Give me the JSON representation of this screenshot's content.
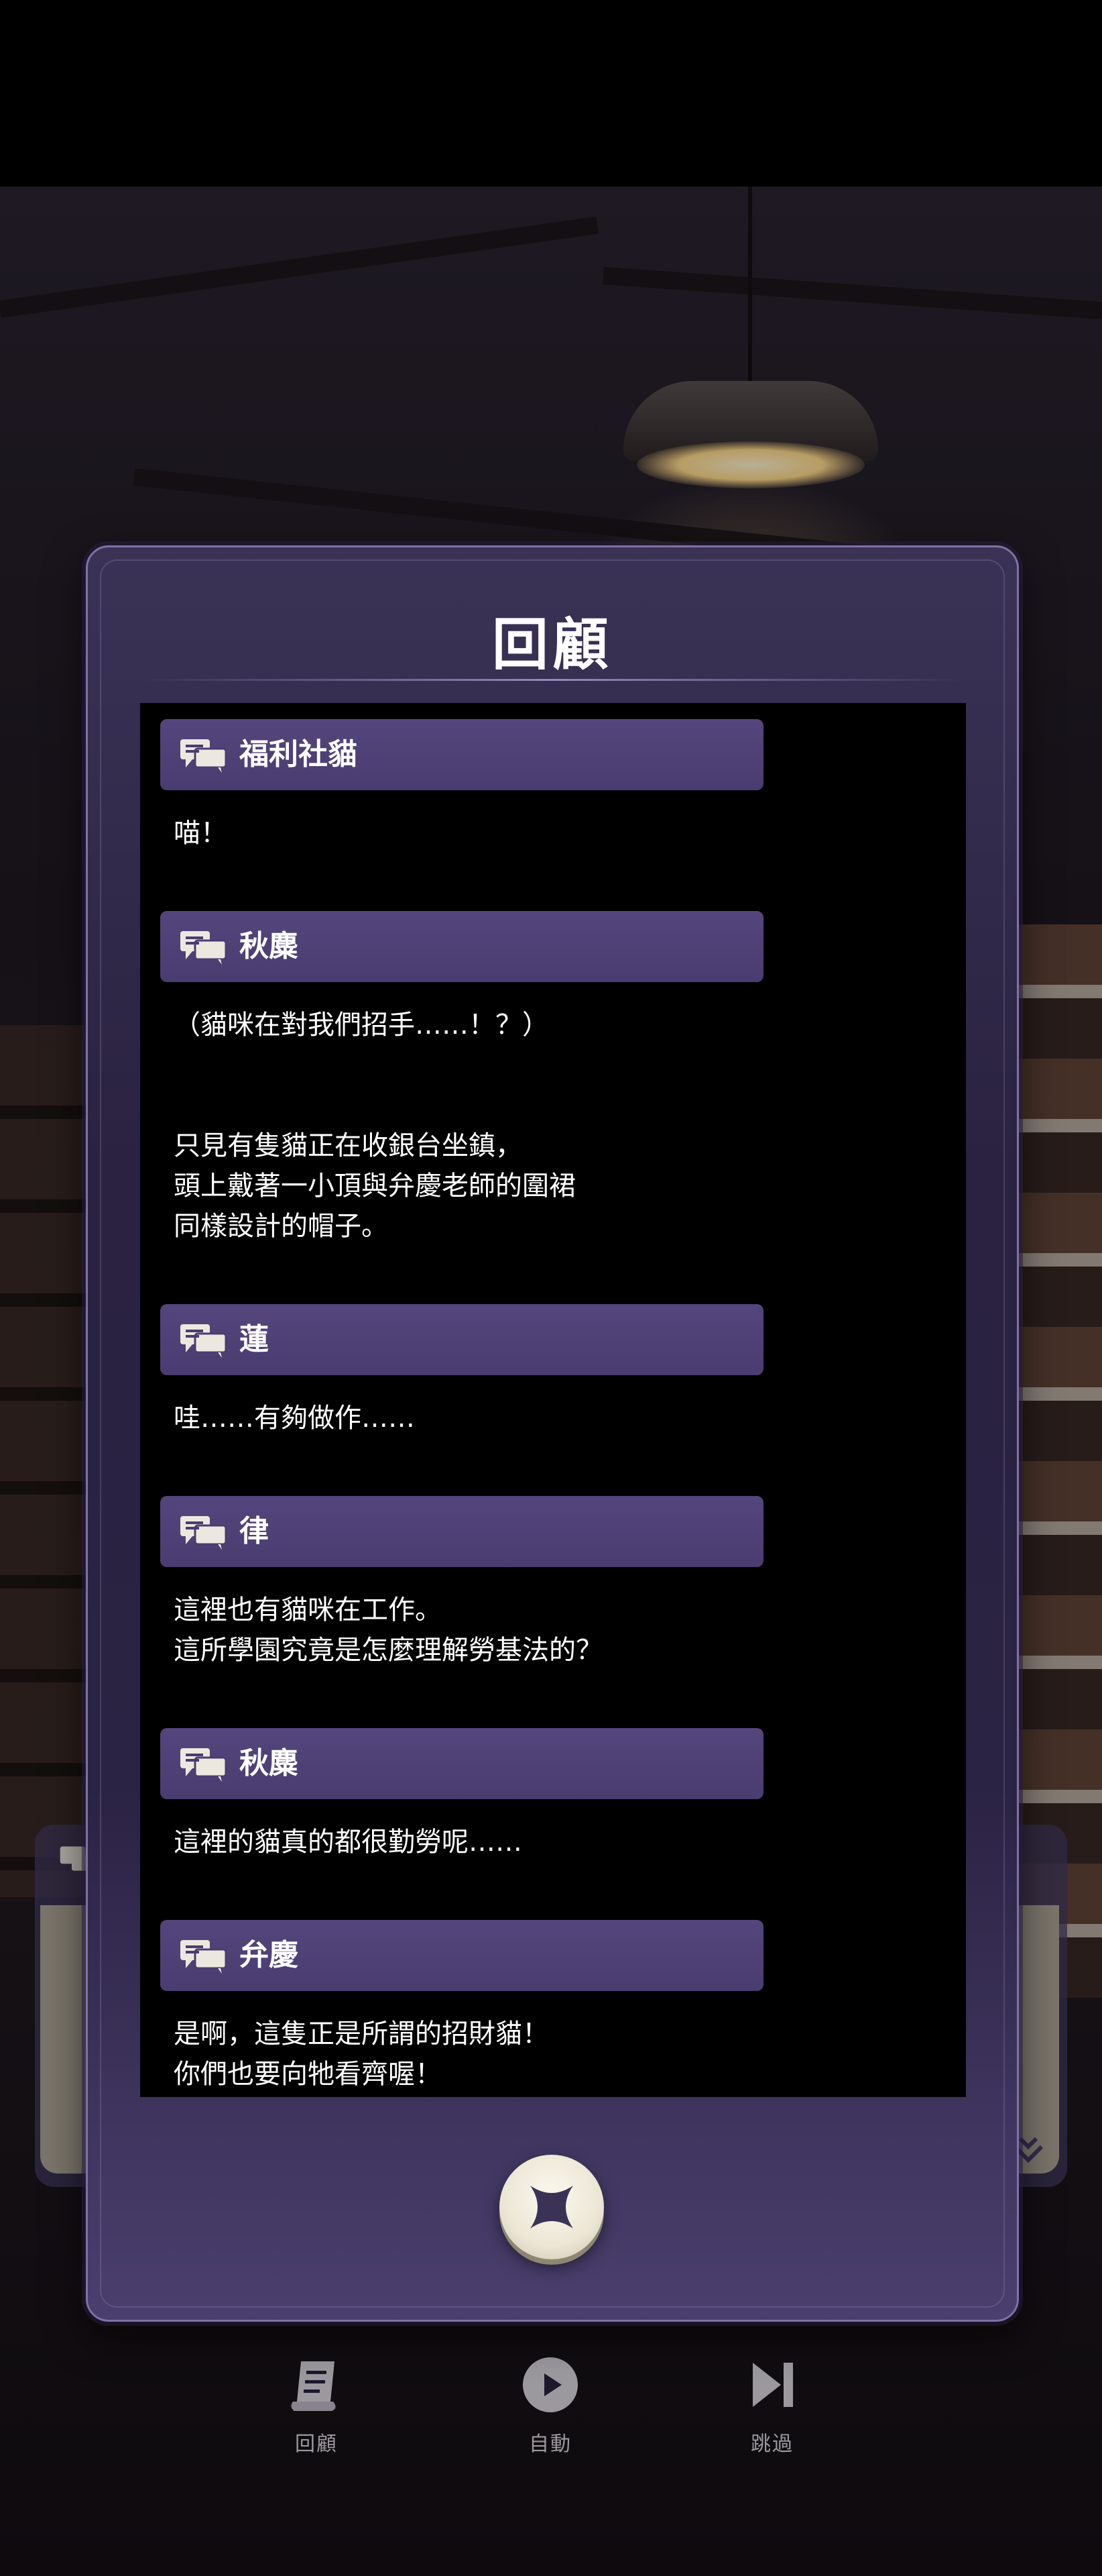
{
  "modal": {
    "title": "回顧",
    "close_icon": "close-x-icon"
  },
  "entries": [
    {
      "speaker": "福利社貓",
      "lines": [
        "喵！"
      ]
    },
    {
      "speaker": "秋麋",
      "lines": [
        "（貓咪在對我們招手……！？）",
        "",
        "",
        "只見有隻貓正在收銀台坐鎮，",
        "頭上戴著一小頂與弁慶老師的圍裙",
        "同樣設計的帽子。"
      ]
    },
    {
      "speaker": "蓮",
      "lines": [
        "哇……有夠做作……"
      ]
    },
    {
      "speaker": "律",
      "lines": [
        "這裡也有貓咪在工作。",
        "這所學園究竟是怎麼理解勞基法的？"
      ]
    },
    {
      "speaker": "秋麋",
      "lines": [
        "這裡的貓真的都很勤勞呢……"
      ]
    },
    {
      "speaker": "弁慶",
      "lines": [
        "是啊，這隻正是所謂的招財貓！",
        "你們也要向牠看齊喔！"
      ]
    }
  ],
  "toolbar": {
    "review_label": "回顧",
    "auto_label": "自動",
    "skip_label": "跳過"
  },
  "colors": {
    "modal_bg": "#2a2240",
    "name_bar": "#4a3c70",
    "log_bg": "#000000",
    "text": "#ffffff"
  }
}
